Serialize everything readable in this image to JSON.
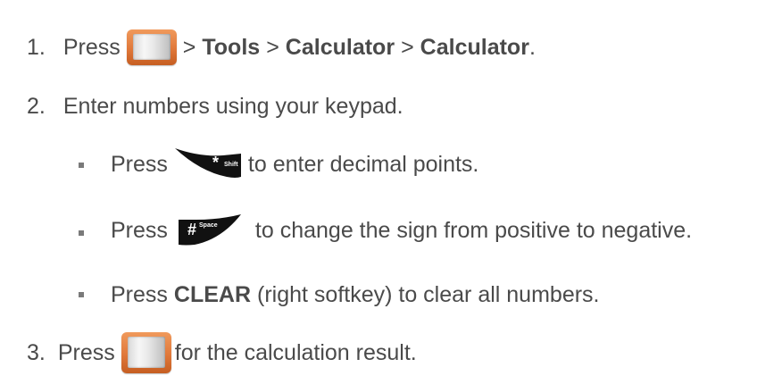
{
  "steps": {
    "s1": {
      "num": "1.",
      "press": "Press",
      "sep1": ">",
      "tools": "Tools",
      "sep2": ">",
      "calc1": "Calculator",
      "sep3": ">",
      "calc2": "Calculator",
      "end": "."
    },
    "s2": {
      "num": "2.",
      "text": "Enter numbers using your keypad."
    },
    "b1": {
      "press": "Press",
      "key_main": "*",
      "key_sub": "Shift",
      "text": "to enter decimal points."
    },
    "b2": {
      "press": "Press",
      "key_main": "#",
      "key_sub": "Space",
      "text": "to change the sign from positive to negative."
    },
    "b3": {
      "press": "Press",
      "clear": "CLEAR",
      "text": "(right softkey) to clear all numbers."
    },
    "s3": {
      "num": "3.",
      "press": "Press",
      "text": "for the calculation result."
    }
  },
  "colors": {
    "text": "#4a4a4a",
    "key_orange": "#e0783a",
    "key_black": "#111111"
  },
  "icons": {
    "menu_key": "menu-ok-key-icon",
    "star_key": "star-shift-key-icon",
    "pound_key": "pound-space-key-icon"
  }
}
